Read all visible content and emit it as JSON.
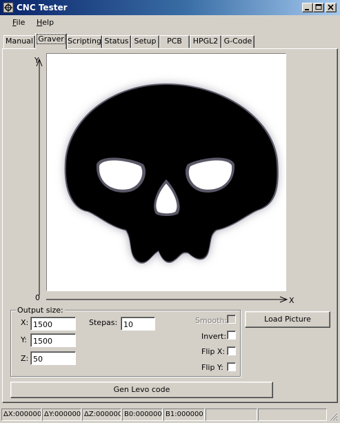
{
  "window": {
    "title": "CNC Tester"
  },
  "menu": [
    {
      "label": "File",
      "accel": "F",
      "rest": "ile"
    },
    {
      "label": "Help",
      "accel": "H",
      "rest": "elp"
    }
  ],
  "tabs": [
    {
      "label": "Manual",
      "active": false
    },
    {
      "label": "Graver",
      "active": true
    },
    {
      "label": "Scripting",
      "active": false
    },
    {
      "label": "Status",
      "active": false
    },
    {
      "label": "Setup",
      "active": false
    },
    {
      "label": "PCB",
      "active": false
    },
    {
      "label": "HPGL2",
      "active": false
    },
    {
      "label": "G-Code",
      "active": false
    }
  ],
  "axes": {
    "y_label": "Y",
    "x_label": "X",
    "origin_label": "0"
  },
  "picture": {
    "icon": "skull-image"
  },
  "output_group": {
    "legend": "Output size:",
    "x_label": "X:",
    "x_value": "1500",
    "y_label": "Y:",
    "y_value": "1500",
    "z_label": "Z:",
    "z_value": "50",
    "stepas_label": "Stepas:",
    "stepas_value": "10",
    "smooth_label": "Smooth:",
    "invert_label": "Invert:",
    "flipx_label": "Flip X:",
    "flipy_label": "Flip Y:"
  },
  "buttons": {
    "load_picture": "Load Picture",
    "gen_code": "Gen Levo code"
  },
  "statusbar": {
    "dx": "ΔX:000000",
    "dy": "ΔY:000000",
    "dz": "ΔZ:000000",
    "b0": "B0:000000",
    "b1": "B1:000000",
    "empty": ""
  },
  "colors": {
    "title_start": "#0a246a",
    "title_end": "#a6caf0",
    "face": "#d4d0c8"
  }
}
